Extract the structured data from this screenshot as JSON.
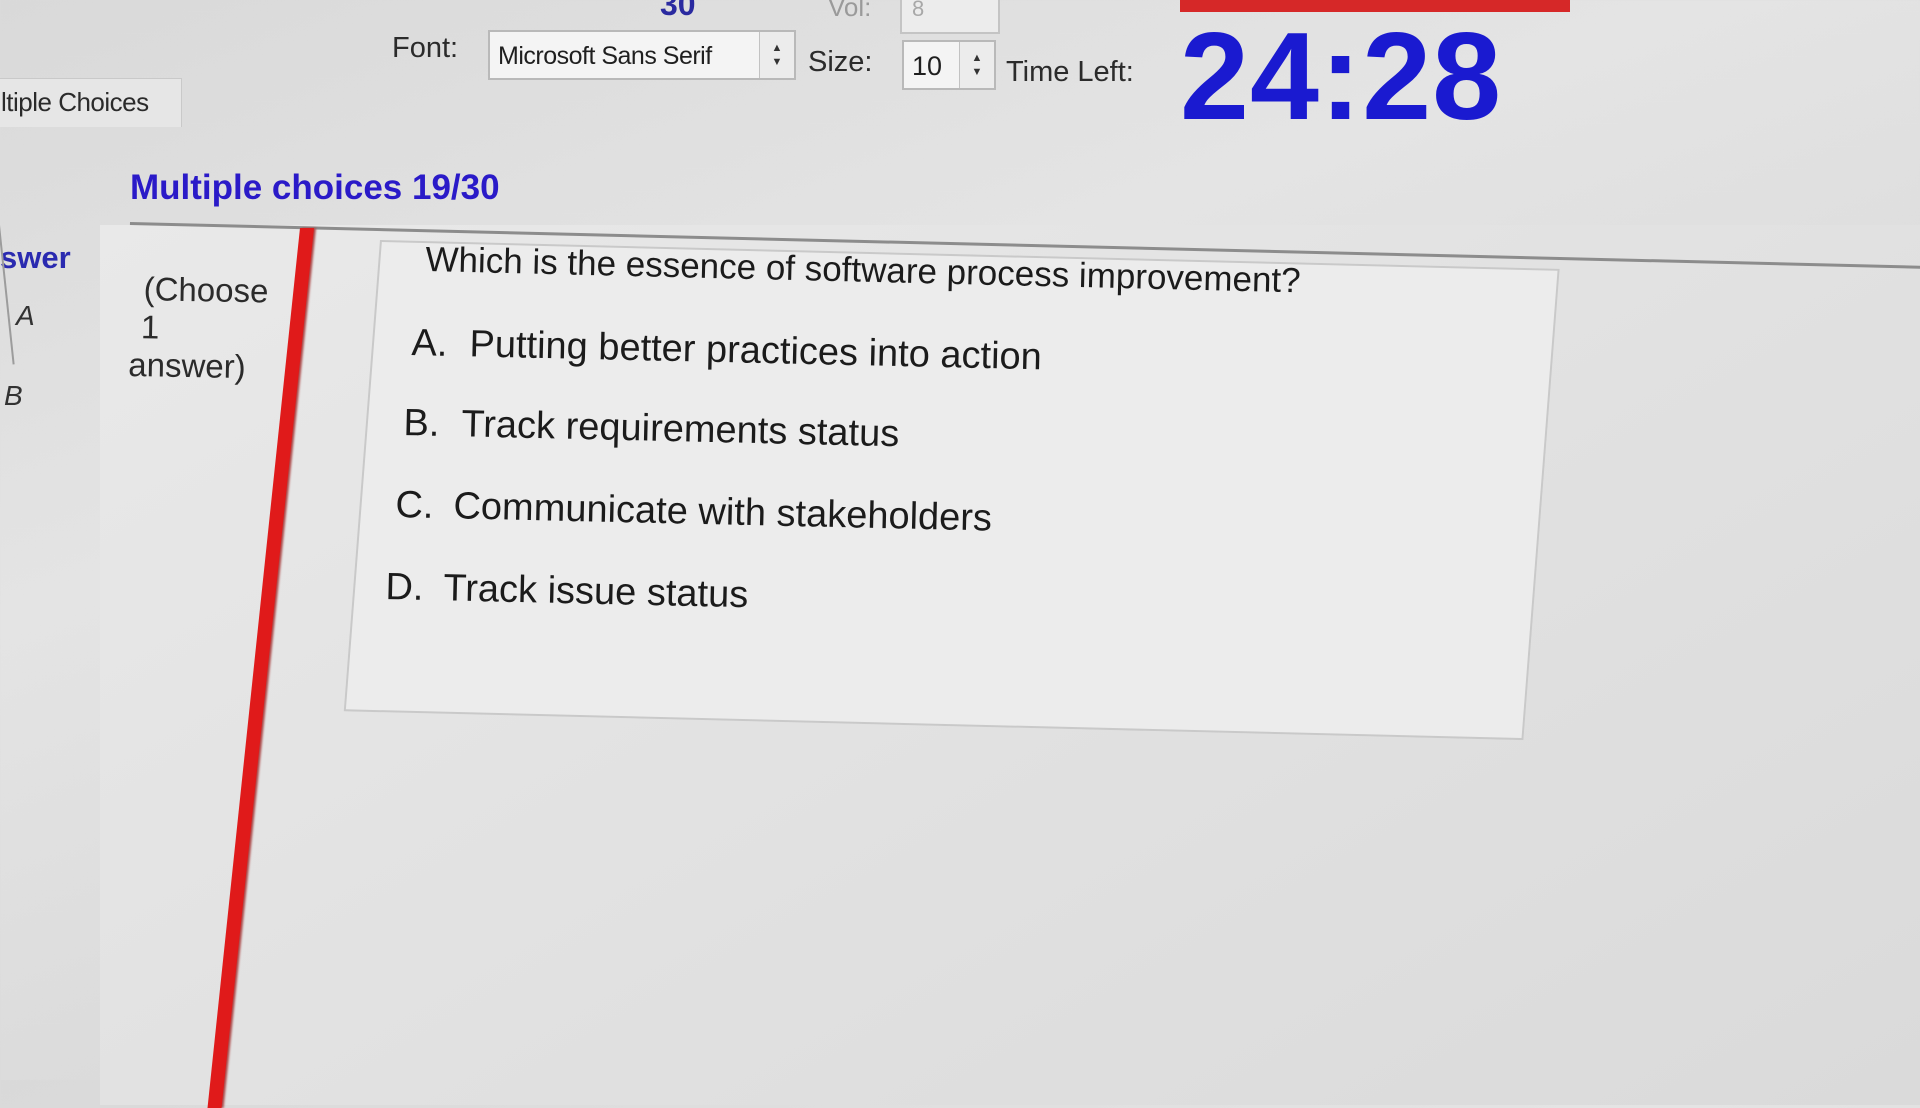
{
  "toolbar": {
    "marks_partial": "30",
    "vol_label": "Vol:",
    "vol_value": "8",
    "font_label": "Font:",
    "font_value": "Microsoft Sans Serif",
    "size_label": "Size:",
    "size_value": "10",
    "time_left_label": "Time Left:",
    "timer": "24:28",
    "accent": "#1a1ad0",
    "alert": "#d62828"
  },
  "tab": {
    "label": "ltiple Choices"
  },
  "heading": "Multiple choices 19/30",
  "side": {
    "answer_label": "swer",
    "row_a": "A",
    "row_b": "B"
  },
  "instruction": {
    "line1": "(Choose",
    "line2": "1",
    "line3": "answer)"
  },
  "question": {
    "text": "Which is the essence of software process improvement?",
    "options": [
      {
        "letter": "A.",
        "text": "Putting better practices into action"
      },
      {
        "letter": "B.",
        "text": "Track requirements status"
      },
      {
        "letter": "C.",
        "text": "Communicate with stakeholders"
      },
      {
        "letter": "D.",
        "text": "Track issue status"
      }
    ]
  }
}
